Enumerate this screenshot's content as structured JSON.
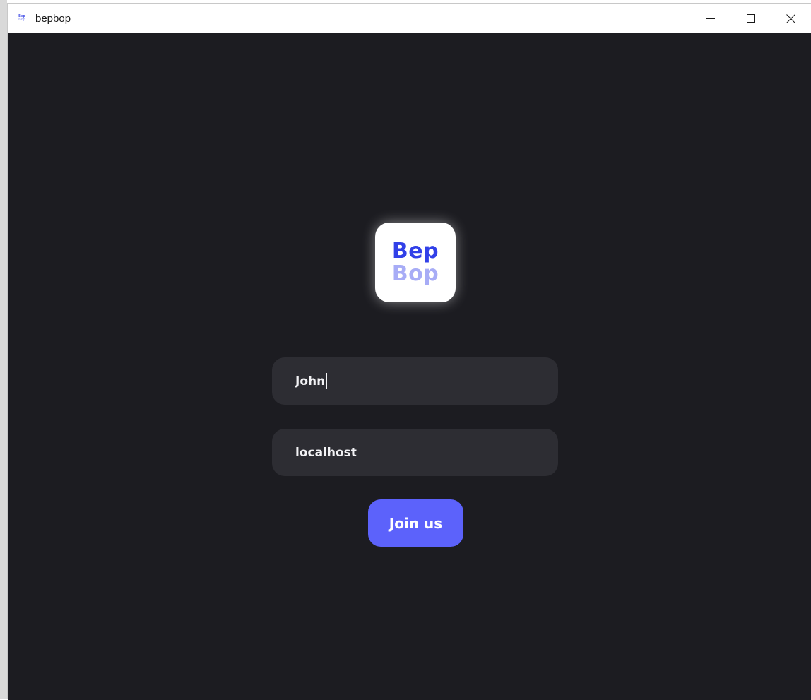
{
  "window": {
    "title": "bepbop",
    "app_icon": {
      "line1": "Bep",
      "line2": "Bop"
    },
    "controls": {
      "minimize_icon": "minimize-icon",
      "maximize_icon": "maximize-icon",
      "close_icon": "close-icon"
    }
  },
  "logo": {
    "line1": "Bep",
    "line2": "Bop"
  },
  "form": {
    "name_value": "John",
    "host_value": "localhost",
    "join_label": "Join us"
  },
  "colors": {
    "background": "#1c1c21",
    "field": "#2d2d33",
    "accent": "#5c62fb",
    "logo_primary": "#3140e8",
    "logo_secondary": "#a7acf6"
  }
}
